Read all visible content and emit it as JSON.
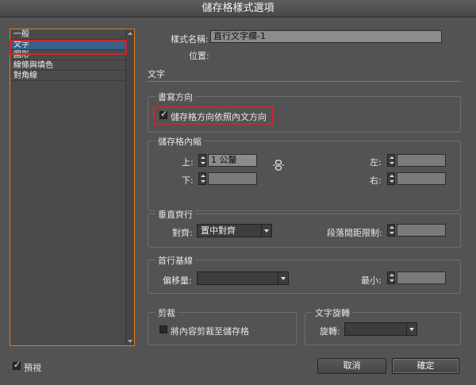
{
  "window": {
    "title": "儲存格樣式選項"
  },
  "sidebar": {
    "items": [
      {
        "label": "一般"
      },
      {
        "label": "文字"
      },
      {
        "label": "圖形"
      },
      {
        "label": "線條與填色"
      },
      {
        "label": "對角線"
      }
    ],
    "selected_index": 1
  },
  "header": {
    "style_name_label": "樣式名稱:",
    "style_name_value": "直行文字欄-1",
    "position_label": "位置:"
  },
  "text_section": {
    "title": "文字"
  },
  "writing_direction": {
    "title": "書寫方向",
    "checkbox_label": "儲存格方向依照內文方向",
    "checked": true
  },
  "cell_inset": {
    "title": "儲存格內縮",
    "top_label": "上:",
    "top_value": "1 公釐",
    "bottom_label": "下:",
    "bottom_value": "",
    "left_label": "左:",
    "left_value": "",
    "right_label": "右:",
    "right_value": "",
    "link_icon": "chain-link-icon"
  },
  "vertical_justification": {
    "title": "垂直齊行",
    "align_label": "對齊:",
    "align_value": "置中對齊",
    "para_spacing_label": "段落間距限制:",
    "para_spacing_value": ""
  },
  "first_baseline": {
    "title": "首行基線",
    "offset_label": "偏移量:",
    "offset_value": "",
    "min_label": "最小:",
    "min_value": ""
  },
  "clipping": {
    "title": "剪裁",
    "checkbox_label": "將內容剪裁至儲存格",
    "checked": false
  },
  "text_rotation": {
    "title": "文字旋轉",
    "rotate_label": "旋轉:",
    "rotate_value": ""
  },
  "footer": {
    "preview_label": "預視",
    "preview_checked": true,
    "cancel_label": "取消",
    "ok_label": "確定"
  },
  "colors": {
    "highlight": "#d0242b",
    "sidebar_focus": "#e07a22",
    "selection": "#3a5f8a"
  }
}
